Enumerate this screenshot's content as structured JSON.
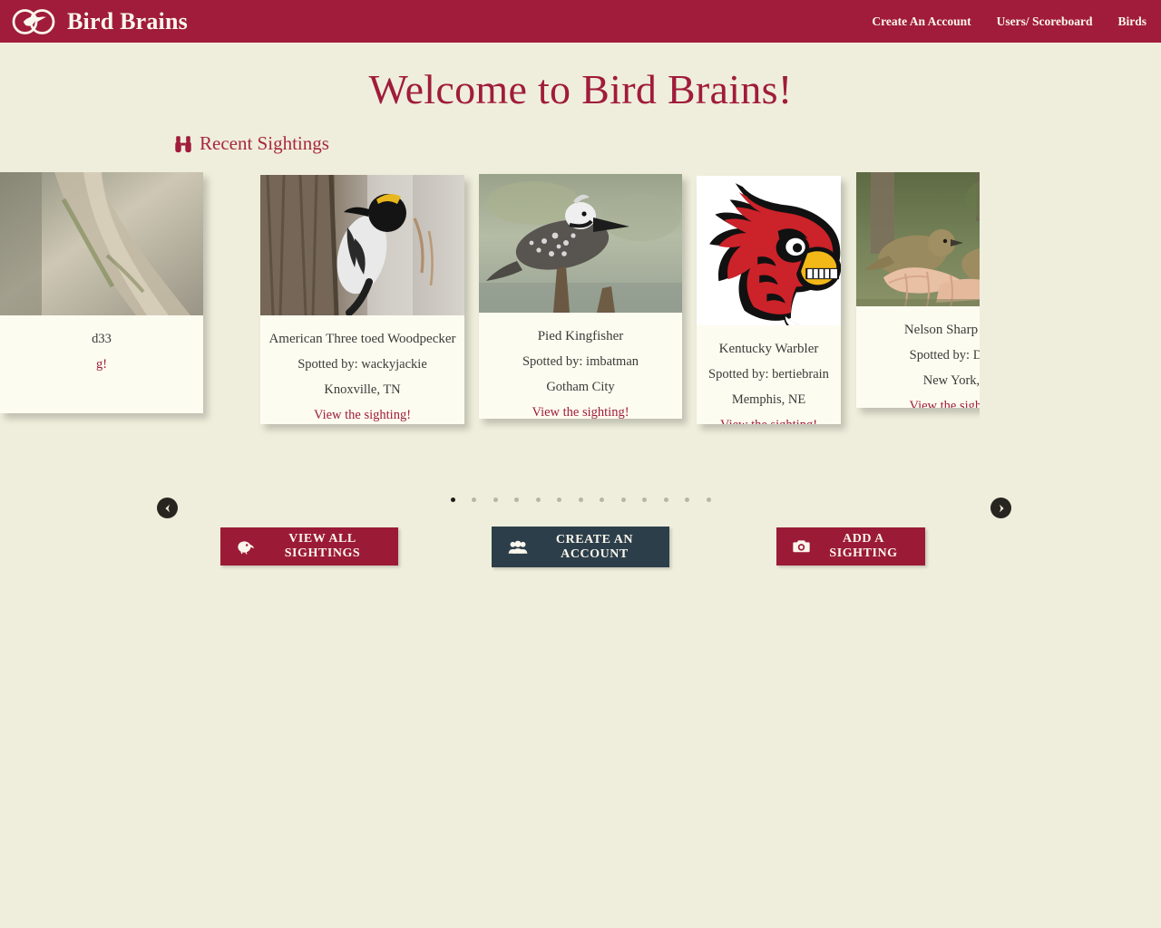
{
  "header": {
    "brand_name": "Bird Brains",
    "logo_icon": "bird-infinity-logo",
    "nav": [
      {
        "label": "Create An Account",
        "name": "nav-create-account"
      },
      {
        "label": "Users/ Scoreboard",
        "name": "nav-users-scoreboard"
      },
      {
        "label": "Birds",
        "name": "nav-birds"
      }
    ]
  },
  "page": {
    "title": "Welcome to Bird Brains!"
  },
  "section": {
    "icon": "binoculars-icon",
    "title": "Recent Sightings"
  },
  "carousel": {
    "prev_icon": "chevron-left-icon",
    "next_icon": "chevron-right-icon",
    "dot_count": 13,
    "active_dot": 0,
    "cards": [
      {
        "name": "",
        "spotted_by": "d33",
        "location": "",
        "link": "g!",
        "photo": "bird-on-branch-photo",
        "clipped": "left"
      },
      {
        "name": "American Three toed Woodpecker",
        "spotted_by": "Spotted by: wackyjackie",
        "location": "Knoxville, TN",
        "link": "View the sighting!",
        "photo": "woodpecker-on-tree-photo",
        "clipped": "none"
      },
      {
        "name": "Pied Kingfisher",
        "spotted_by": "Spotted by: imbatman",
        "location": "Gotham City",
        "link": "View the sighting!",
        "photo": "pied-kingfisher-photo",
        "clipped": "none"
      },
      {
        "name": "Kentucky Warbler",
        "spotted_by": "Spotted by: bertiebrain",
        "location": "Memphis, NE",
        "link": "View the sighting!",
        "photo": "cardinal-mascot-logo-photo",
        "clipped": "none"
      },
      {
        "name": "Nelson Sharp tailed",
        "spotted_by": "Spotted by: Dee R",
        "location": "New York, N",
        "link": "View the sighting!",
        "photo": "sparrows-in-hand-photo",
        "clipped": "right"
      }
    ]
  },
  "actions": [
    {
      "label": "VIEW ALL SIGHTINGS",
      "icon": "kiwi-bird-icon",
      "name": "view-all-sightings-button"
    },
    {
      "label": "CREATE AN ACCOUNT",
      "icon": "users-icon",
      "name": "create-account-button"
    },
    {
      "label": "ADD A SIGHTING",
      "icon": "camera-icon",
      "name": "add-sighting-button"
    }
  ],
  "colors": {
    "brand_crimson": "#A01C3A",
    "button_crimson": "#9B1B36",
    "button_dark": "#2C3E4A",
    "background": "#EFEEDC",
    "card_background": "#FDFCF0"
  }
}
